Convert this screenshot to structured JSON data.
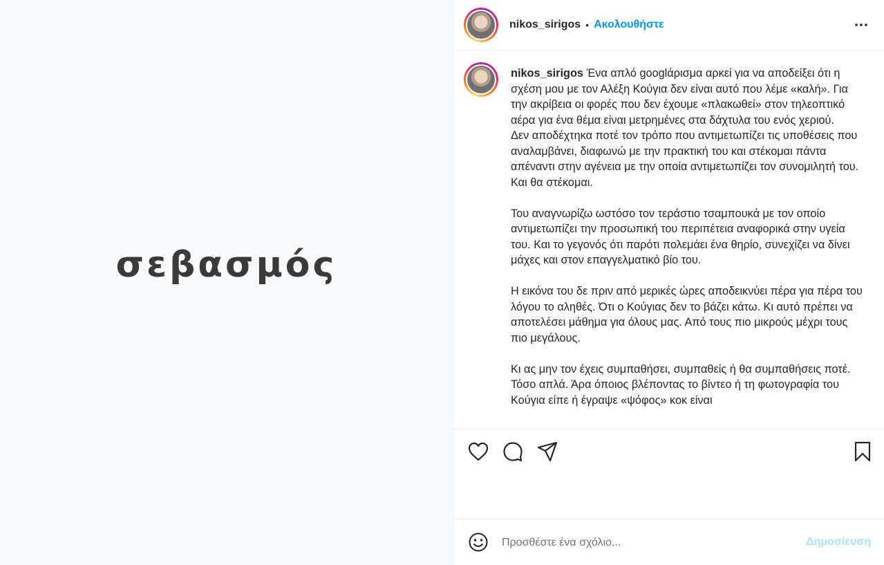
{
  "media": {
    "text": "σεβασμός"
  },
  "header": {
    "username": "nikos_sirigos",
    "separator": "•",
    "follow_label": "Ακολουθήστε",
    "more_icon": "more-horizontal-icon"
  },
  "caption": {
    "username": "nikos_sirigos",
    "text": "Ένα απλό googlάρισμα αρκεί για να αποδείξει ότι η σχέση μου με τον Αλέξη Κούγια δεν είναι αυτό που λέμε «καλή». Για την ακρίβεια οι φορές που δεν έχουμε «πλακωθεί» στον τηλεοπτικό αέρα για ένα θέμα είναι μετρημένες στα δάχτυλα του ενός χεριού.\nΔεν αποδέχτηκα ποτέ τον τρόπο που αντιμετωπίζει τις υποθέσεις που αναλαμβάνει, διαφωνώ με την πρακτική του και στέκομαι πάντα απέναντι στην αγένεια με την οποία αντιμετωπίζει τον συνομιλητή του. Και θα στέκομαι.\n\nΤου αναγνωρίζω ωστόσο τον τεράστιο τσαμπουκά με τον οποίο αντιμετωπίζει την προσωπική του περιπέτεια αναφορικά στην υγεία του. Και το γεγονός ότι παρότι πολεμάει ένα θηρίο, συνεχίζει να δίνει μάχες και στον επαγγελματικό βίο του.\n\nΗ εικόνα του δε πριν από μερικές ώρες αποδεικνύει πέρα για πέρα του λόγου το αληθές. Ότι ο Κούγιας δεν το βάζει κάτω. Κι αυτό πρέπει να αποτελέσει μάθημα για όλους μας. Από τους πιο μικρούς μέχρι τους πιο μεγάλους.\n\nΚι ας μην τον έχεις συμπαθήσει, συμπαθείς ή θα συμπαθήσεις ποτέ. Τόσο απλά. Άρα όποιος βλέποντας το βίντεο ή τη φωτογραφία του Κούγια είπε ή έγραψε «ψόφος» κοκ είναι"
  },
  "actions": {
    "like_icon": "heart-icon",
    "comment_icon": "comment-icon",
    "share_icon": "paper-plane-icon",
    "save_icon": "bookmark-icon"
  },
  "comment": {
    "emoji_icon": "smiley-icon",
    "placeholder": "Προσθέστε ένα σχόλιο...",
    "post_label": "Δημοσίευση"
  },
  "colors": {
    "accent": "#0095f6",
    "post_disabled": "#b2dffc",
    "text": "#262626"
  }
}
